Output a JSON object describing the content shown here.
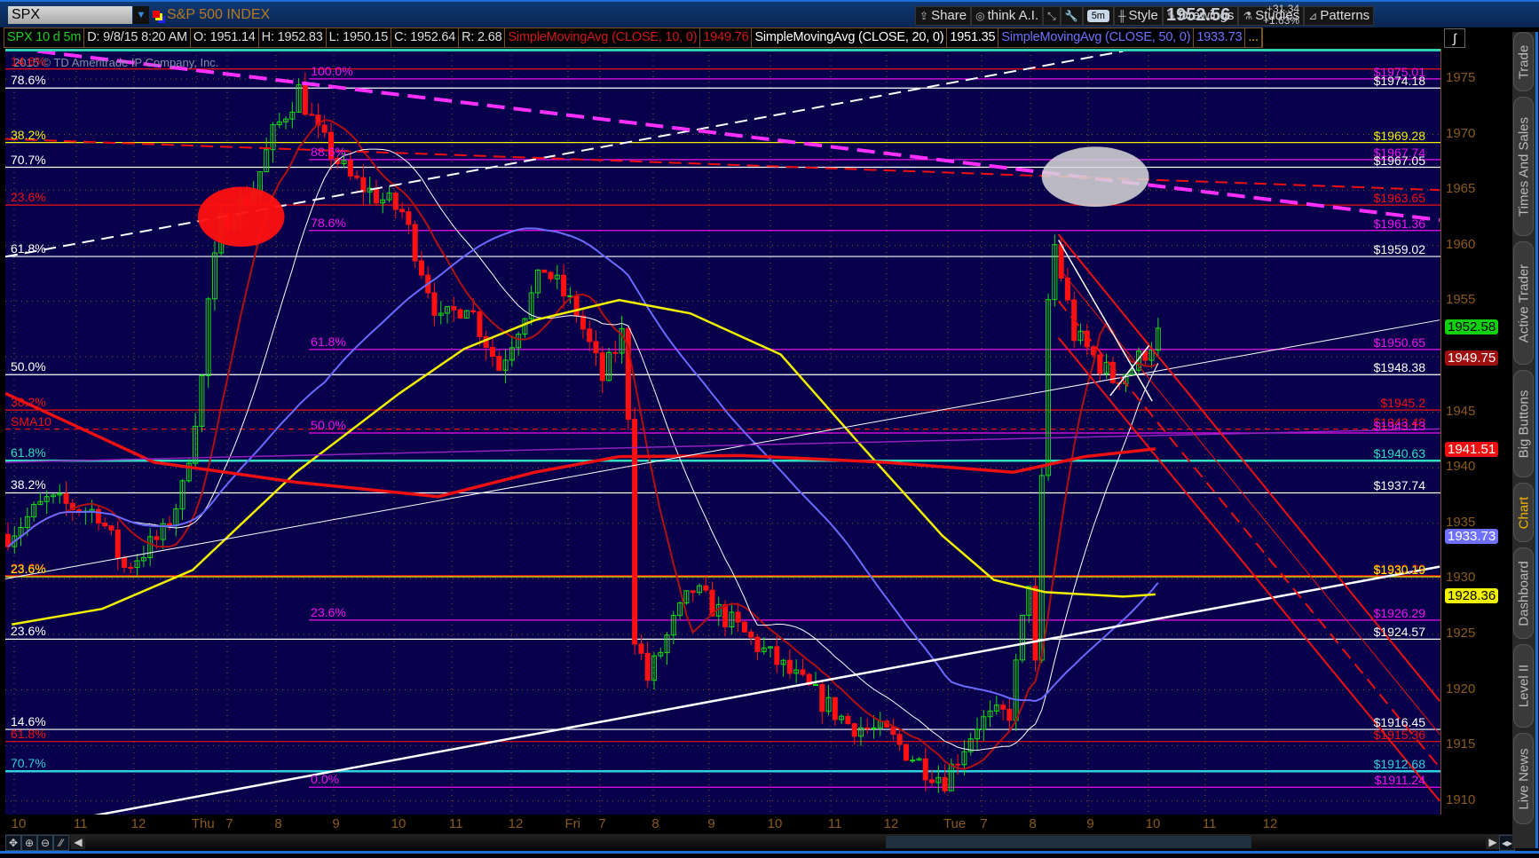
{
  "topbar": {
    "symbol": "SPX",
    "symbol_name": "S&P 500 INDEX",
    "tools": [
      {
        "icon": "share-icon",
        "glyph": "⇪",
        "label": "Share"
      },
      {
        "icon": "think-ai-icon",
        "glyph": "◎",
        "label": "think A.I."
      },
      {
        "icon": "cursor-icon",
        "glyph": "⤡",
        "label": ""
      },
      {
        "icon": "wrench-icon",
        "glyph": "🔧",
        "label": ""
      },
      {
        "icon": "aggregation-icon",
        "glyph": "",
        "label": "5m"
      },
      {
        "icon": "candle-style-icon",
        "glyph": "╫",
        "label": "Style"
      },
      {
        "icon": "pencil-icon",
        "glyph": "✎",
        "label": "Drawings"
      },
      {
        "icon": "studies-icon",
        "glyph": "⚗",
        "label": "Studies"
      },
      {
        "icon": "patterns-icon",
        "glyph": "⊿",
        "label": "Patterns"
      }
    ],
    "last_price": "1952.56",
    "change": "+31.34",
    "change_pct": "+1.63%"
  },
  "legend": [
    {
      "text": "SPX 10 d 5m",
      "color": "#22cc22"
    },
    {
      "text": "D: 9/8/15 8:20 AM",
      "color": "#dddddd"
    },
    {
      "text": "O: 1951.14",
      "color": "#dddddd"
    },
    {
      "text": "H: 1952.83",
      "color": "#dddddd"
    },
    {
      "text": "L: 1950.15",
      "color": "#dddddd"
    },
    {
      "text": "C: 1952.64",
      "color": "#dddddd"
    },
    {
      "text": "R: 2.68",
      "color": "#dddddd"
    },
    {
      "text": "SimpleMovingAvg (CLOSE, 10, 0)",
      "color": "#d01818"
    },
    {
      "text": "1949.76",
      "color": "#d01818"
    },
    {
      "text": "SimpleMovingAvg (CLOSE, 20, 0)",
      "color": "#ffffff"
    },
    {
      "text": "1951.35",
      "color": "#ffffff"
    },
    {
      "text": "SimpleMovingAvg (CLOSE, 50, 0)",
      "color": "#7070ff"
    },
    {
      "text": "1933.73",
      "color": "#7070ff"
    },
    {
      "text": "...",
      "color": "#e0c000"
    }
  ],
  "watermark": "2015 © TD Ameritrade IP Company, Inc.",
  "price_axis": {
    "ticks": [
      "1975",
      "1970",
      "1965",
      "1960",
      "1955",
      "1950",
      "1945",
      "1940",
      "1935",
      "1930",
      "1925",
      "1920",
      "1915",
      "1910"
    ],
    "tags": [
      {
        "value": "1952.58",
        "bg": "#10d010",
        "fg": "#000000"
      },
      {
        "value": "1949.75",
        "bg": "#a01010",
        "fg": "#ffffff"
      },
      {
        "value": "1941.51",
        "bg": "#ee1010",
        "fg": "#ffffff"
      },
      {
        "value": "1933.73",
        "bg": "#7070ff",
        "fg": "#ffffff"
      },
      {
        "value": "1928.36",
        "bg": "#f0f000",
        "fg": "#000000"
      }
    ]
  },
  "time_axis": [
    "10",
    "11",
    "12",
    "Thu",
    "7",
    "8",
    "9",
    "10",
    "11",
    "12",
    "Fri",
    "7",
    "8",
    "9",
    "10",
    "11",
    "12",
    "Tue",
    "7",
    "8",
    "9",
    "10",
    "11",
    "12"
  ],
  "fib_levels": [
    {
      "price": 1975.9,
      "color": "#ee1010",
      "left": "14.6%",
      "right": "",
      "start_bar": 0
    },
    {
      "price": 1975.01,
      "color": "#ee10ee",
      "left": "100.0%",
      "right": "$1975.01",
      "start_bar": 47
    },
    {
      "price": 1974.18,
      "color": "#ffffff",
      "left": "78.6%",
      "right": "$1974.18",
      "start_bar": 0
    },
    {
      "price": 1969.28,
      "color": "#f0f000",
      "left": "38.2%",
      "right": "$1969.28",
      "start_bar": 0
    },
    {
      "price": 1967.74,
      "color": "#ee10ee",
      "left": "88.6%",
      "right": "$1967.74",
      "start_bar": 47
    },
    {
      "price": 1967.05,
      "color": "#ffffff",
      "left": "70.7%",
      "right": "$1967.05",
      "start_bar": 0
    },
    {
      "price": 1963.65,
      "color": "#ee1010",
      "left": "23.6%",
      "right": "$1963.65",
      "start_bar": 0
    },
    {
      "price": 1961.36,
      "color": "#ee10ee",
      "left": "78.6%",
      "right": "$1961.36",
      "start_bar": 47
    },
    {
      "price": 1959.02,
      "color": "#ffffff",
      "left": "61.8%",
      "right": "$1959.02",
      "start_bar": 0
    },
    {
      "price": 1950.65,
      "color": "#ee10ee",
      "left": "61.8%",
      "right": "$1950.65",
      "start_bar": 47
    },
    {
      "price": 1948.38,
      "color": "#ffffff",
      "left": "50.0%",
      "right": "$1948.38",
      "start_bar": 0
    },
    {
      "price": 1945.2,
      "color": "#ee1010",
      "left": "38.2%",
      "right": "$1945.2",
      "start_bar": 0
    },
    {
      "price": 1943.48,
      "color": "#ee1010",
      "left": "SMA10",
      "right": "$1943.48",
      "start_bar": 0,
      "dashed": true
    },
    {
      "price": 1943.13,
      "color": "#ee10ee",
      "left": "50.0%",
      "right": "$1943.13",
      "start_bar": 47
    },
    {
      "price": 1940.63,
      "color": "#30e0c0",
      "left": "61.8%",
      "right": "$1940.63",
      "start_bar": 0
    },
    {
      "price": 1937.74,
      "color": "#ffffff",
      "left": "38.2%",
      "right": "$1937.74",
      "start_bar": 0
    },
    {
      "price": 1930.29,
      "color": "#ee1010",
      "left": "23.6%",
      "right": "$1930.29",
      "start_bar": 0
    },
    {
      "price": 1930.19,
      "color": "#f0f000",
      "left": "23.6%",
      "right": "$1930.19",
      "start_bar": 0
    },
    {
      "price": 1926.29,
      "color": "#ee10ee",
      "left": "23.6%",
      "right": "$1926.29",
      "start_bar": 47
    },
    {
      "price": 1924.57,
      "color": "#ffffff",
      "left": "23.6%",
      "right": "$1924.57",
      "start_bar": 0
    },
    {
      "price": 1916.45,
      "color": "#ffffff",
      "left": "14.6%",
      "right": "$1916.45",
      "start_bar": 0
    },
    {
      "price": 1915.36,
      "color": "#ee1010",
      "left": "61.8%",
      "right": "$1915.36",
      "start_bar": 0
    },
    {
      "price": 1912.68,
      "color": "#30d0e0",
      "left": "70.7%",
      "right": "$1912.68",
      "start_bar": 0
    },
    {
      "price": 1911.24,
      "color": "#ee10ee",
      "left": "0.0%",
      "right": "$1911.24",
      "start_bar": 47
    }
  ],
  "chart_data": {
    "type": "candlestick",
    "symbol": "SPX",
    "aggregation": "5m",
    "ylim": [
      1908.5,
      1977.5
    ],
    "x_range_bars": [
      0,
      222
    ],
    "price_path": [
      [
        0,
        1934
      ],
      [
        2,
        1935
      ],
      [
        6,
        1937
      ],
      [
        14,
        1936
      ],
      [
        18,
        1931
      ],
      [
        24,
        1934
      ],
      [
        27,
        1938
      ],
      [
        30,
        1948
      ],
      [
        31,
        1955
      ],
      [
        33,
        1962
      ],
      [
        38,
        1965
      ],
      [
        41,
        1970
      ],
      [
        45,
        1974
      ],
      [
        48,
        1970
      ],
      [
        53,
        1966
      ],
      [
        61,
        1963
      ],
      [
        67,
        1953
      ],
      [
        71,
        1955
      ],
      [
        76,
        1949
      ],
      [
        83,
        1958
      ],
      [
        88,
        1954
      ],
      [
        92,
        1948
      ],
      [
        95,
        1952
      ],
      [
        96,
        1945
      ],
      [
        97,
        1925
      ],
      [
        99,
        1921
      ],
      [
        103,
        1926
      ],
      [
        106,
        1929
      ],
      [
        112,
        1926
      ],
      [
        118,
        1923
      ],
      [
        124,
        1920
      ],
      [
        130,
        1917
      ],
      [
        136,
        1916
      ],
      [
        142,
        1913
      ],
      [
        145,
        1912
      ],
      [
        150,
        1917
      ],
      [
        155,
        1918
      ],
      [
        158,
        1930
      ],
      [
        159,
        1922
      ],
      [
        161,
        1955
      ],
      [
        162,
        1960
      ],
      [
        165,
        1952
      ],
      [
        168,
        1950
      ],
      [
        171,
        1948
      ],
      [
        174,
        1949
      ],
      [
        178,
        1952
      ]
    ],
    "studies": [
      {
        "name": "SimpleMovingAvg (CLOSE, 10, 0)",
        "period": 10,
        "color": "#b01010",
        "last": 1949.76
      },
      {
        "name": "SimpleMovingAvg (CLOSE, 20, 0)",
        "period": 20,
        "color": "#ffffff",
        "last": 1951.35
      },
      {
        "name": "SimpleMovingAvg (CLOSE, 50, 0)",
        "period": 50,
        "color": "#6a6aff",
        "last": 1933.73
      }
    ],
    "overlay_curves": [
      {
        "color": "#f0f000",
        "width": 2.5,
        "points": [
          [
            1,
            1925.9
          ],
          [
            15,
            1927.3
          ],
          [
            29,
            1930.8
          ],
          [
            45,
            1939.6
          ],
          [
            61,
            1946.7
          ],
          [
            71,
            1950.7
          ],
          [
            82,
            1953.3
          ],
          [
            95,
            1955.1
          ],
          [
            106,
            1953.9
          ],
          [
            120,
            1950.2
          ],
          [
            132,
            1942.3
          ],
          [
            145,
            1933.9
          ],
          [
            153,
            1929.9
          ],
          [
            161,
            1928.8
          ],
          [
            173,
            1928.4
          ],
          [
            178,
            1928.6
          ]
        ]
      },
      {
        "color": "#ee1010",
        "width": 3.5,
        "points": [
          [
            0,
            1946.7
          ],
          [
            23,
            1940.5
          ],
          [
            45,
            1938.7
          ],
          [
            67,
            1937.4
          ],
          [
            82,
            1939.6
          ],
          [
            95,
            1941.0
          ],
          [
            114,
            1941.1
          ],
          [
            136,
            1940.5
          ],
          [
            156,
            1939.6
          ],
          [
            167,
            1941.0
          ],
          [
            178,
            1941.7
          ]
        ]
      }
    ],
    "drawings": [
      {
        "type": "line",
        "color": "#ffffff",
        "width": 2,
        "dash": "14,8",
        "from": [
          0,
          1959
        ],
        "to": [
          173,
          1977.5
        ]
      },
      {
        "type": "line",
        "color": "#ff30ff",
        "width": 4,
        "dash": "20,10",
        "from": [
          5,
          1977.5
        ],
        "to": [
          222,
          1962.3
        ]
      },
      {
        "type": "line",
        "color": "#ee1010",
        "width": 2,
        "dash": "14,8",
        "from": [
          0,
          1969.6
        ],
        "to": [
          222,
          1965
        ]
      },
      {
        "type": "line",
        "color": "#ffffff",
        "width": 1,
        "from": [
          0,
          1930
        ],
        "to": [
          222,
          1953.3
        ]
      },
      {
        "type": "line",
        "color": "#ffffff",
        "width": 2.5,
        "from": [
          12,
          1908.5
        ],
        "to": [
          222,
          1931.1
        ]
      },
      {
        "type": "line",
        "color": "#9020c0",
        "width": 1.5,
        "from": [
          0,
          1940.5
        ],
        "to": [
          222,
          1943.5
        ]
      },
      {
        "type": "line",
        "color": "#ee1010",
        "width": 2,
        "from": [
          163,
          1961
        ],
        "to": [
          222,
          1919
        ]
      },
      {
        "type": "line",
        "color": "#ee1010",
        "width": 1,
        "from": [
          163,
          1958
        ],
        "to": [
          222,
          1916
        ]
      },
      {
        "type": "line",
        "color": "#ee1010",
        "width": 2,
        "dash": "14,8",
        "from": [
          163,
          1955
        ],
        "to": [
          222,
          1913
        ]
      },
      {
        "type": "line",
        "color": "#ee1010",
        "width": 2,
        "from": [
          163,
          1951.7
        ],
        "to": [
          222,
          1910
        ]
      },
      {
        "type": "line",
        "color": "#ffffff",
        "width": 1.5,
        "from": [
          163,
          1960.5
        ],
        "to": [
          177.5,
          1946
        ]
      },
      {
        "type": "line",
        "color": "#ffffff",
        "width": 1.5,
        "from": [
          171,
          1946.5
        ],
        "to": [
          177,
          1951
        ]
      },
      {
        "type": "ellipse",
        "color": "#ff1010",
        "center": [
          36.5,
          1962.6
        ],
        "radius": [
          6.7,
          2.7
        ]
      },
      {
        "type": "ellipse",
        "color": "#d8d8d8",
        "center": [
          168.7,
          1966.2
        ],
        "radius": [
          8.3,
          2.7
        ]
      }
    ]
  },
  "side_tabs": [
    {
      "label": "Trade",
      "active": false
    },
    {
      "label": "Times And Sales",
      "active": false
    },
    {
      "label": "Active Trader",
      "active": false
    },
    {
      "label": "Big Buttons",
      "active": false
    },
    {
      "label": "Chart",
      "active": true
    },
    {
      "label": "Dashboard",
      "active": false
    },
    {
      "label": "Level II",
      "active": false
    },
    {
      "label": "Live News",
      "active": false
    }
  ]
}
